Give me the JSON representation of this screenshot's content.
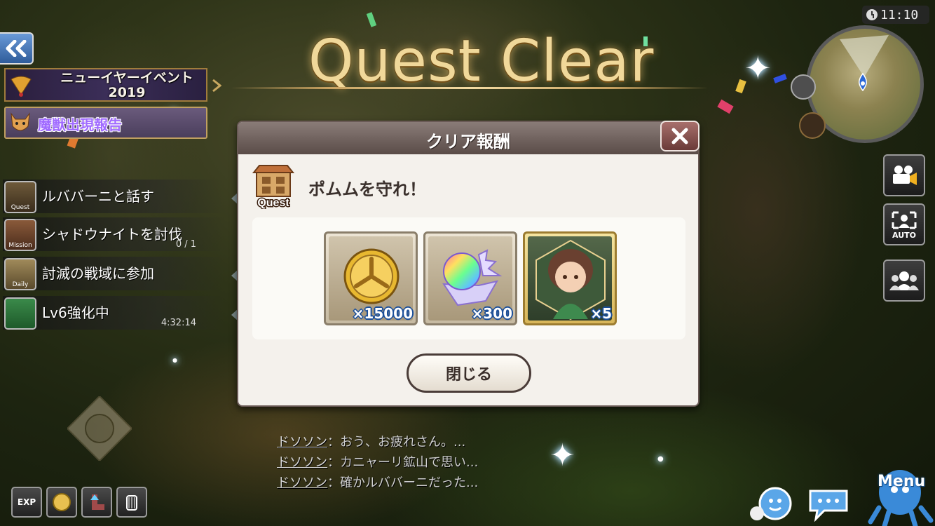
{
  "title": "Quest Clear",
  "clock": {
    "time": "11:10",
    "icon": "clock-icon"
  },
  "left_panel": {
    "event_banner": "ニューイヤーイベント\n2019",
    "monster_report": "魔獣出現報告",
    "tasks": [
      {
        "icon": "quest-icon",
        "icon_label": "Quest",
        "title": "ルババーニと話す",
        "sub": ""
      },
      {
        "icon": "mission-icon",
        "icon_label": "Mission",
        "title": "シャドウナイトを討伐",
        "sub": "0 / 1"
      },
      {
        "icon": "daily-icon",
        "icon_label": "Daily",
        "title": "討滅の戦域に参加",
        "sub": ""
      },
      {
        "icon": "building-icon",
        "icon_label": "",
        "title": "Lv6強化中",
        "sub": "4:32:14"
      }
    ]
  },
  "right_panel": {
    "camera_icon": "video-camera-icon",
    "auto_label": "AUTO",
    "party_icon": "party-icon"
  },
  "dialog": {
    "title": "クリア報酬",
    "quest_icon_label": "Quest",
    "quest_name": "ポムムを守れ！",
    "rewards": [
      {
        "icon": "gold-coin-icon",
        "count": "×15000"
      },
      {
        "icon": "rainbow-crystal-icon",
        "count": "×300"
      },
      {
        "icon": "character-portrait-icon",
        "count": "×5"
      }
    ],
    "close_label": "閉じる"
  },
  "chat": [
    {
      "name": "ドソソン",
      "text": "：おう、お疲れさん。..."
    },
    {
      "name": "ドソソン",
      "text": "：カニャーリ鉱山で思い..."
    },
    {
      "name": "ドソソン",
      "text": "：確かルババーニだった..."
    }
  ],
  "bottom_left": {
    "exp_label": "EXP"
  },
  "bottom_right": {
    "menu_label": "Menu"
  }
}
